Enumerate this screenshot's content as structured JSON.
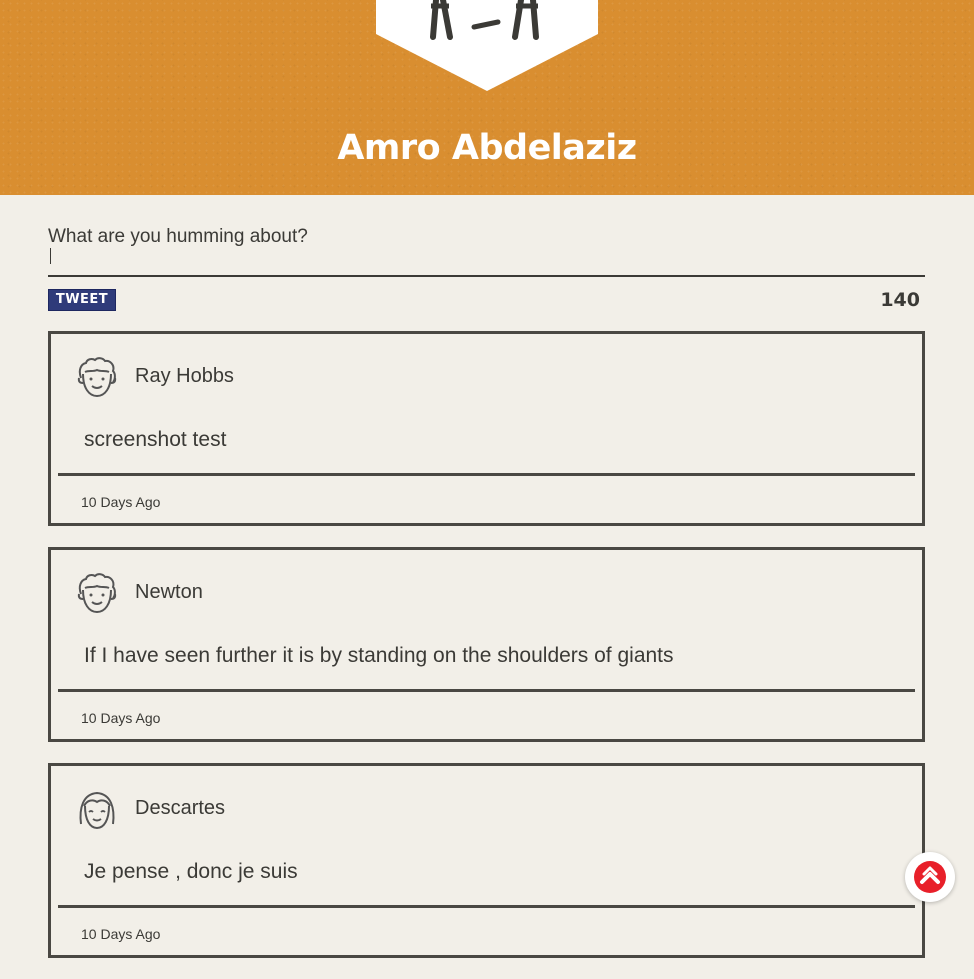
{
  "header": {
    "profile_name": "Amro Abdelaziz",
    "accent_color": "#d98e30",
    "avatar_icon": "character-legs-icon"
  },
  "composer": {
    "placeholder": "What are you humming about?",
    "value": "",
    "tweet_label": "TWEET",
    "char_remaining": "140",
    "button_color": "#2f3b7a"
  },
  "tweets": [
    {
      "author": "Ray Hobbs",
      "avatar_icon": "curly-hair-face-icon",
      "text": "screenshot test",
      "time": "10 Days Ago"
    },
    {
      "author": "Newton",
      "avatar_icon": "curly-hair-face-icon",
      "text": "If I have seen further it is by standing on the shoulders of giants",
      "time": "10 Days Ago"
    },
    {
      "author": "Descartes",
      "avatar_icon": "bob-hair-face-icon",
      "text": "Je pense , donc je suis",
      "time": "10 Days Ago"
    }
  ],
  "scroll_top": {
    "icon": "chevron-up-icon",
    "color": "#e8202a"
  }
}
